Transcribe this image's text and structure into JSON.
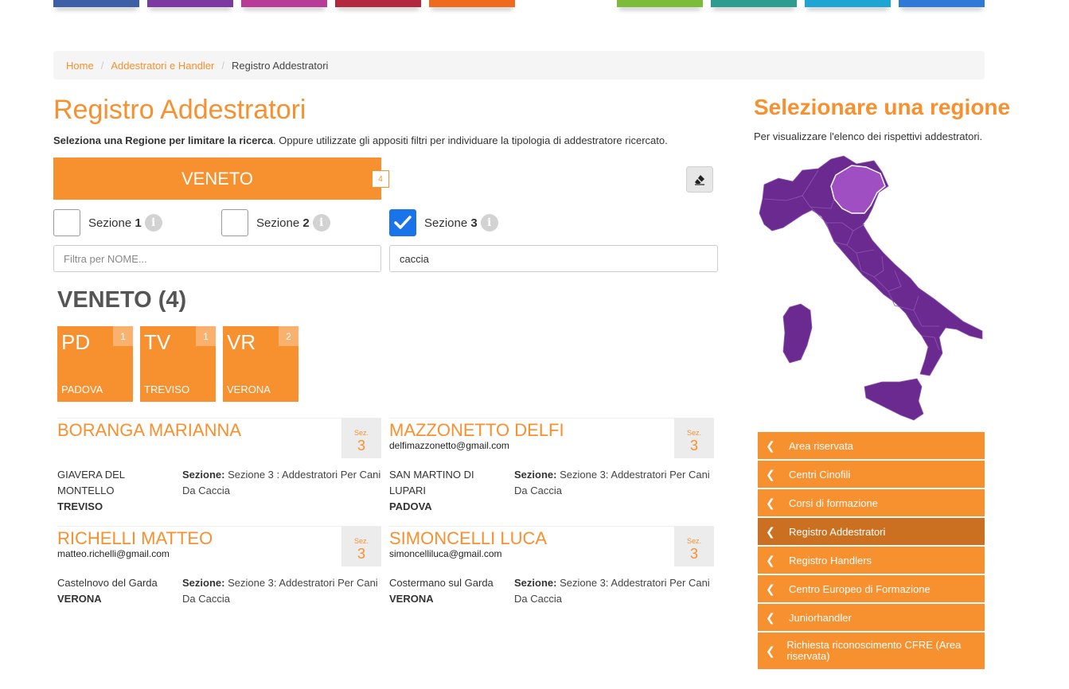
{
  "colors": {
    "accent": "#f7902f",
    "accent_dark": "#cb7020",
    "checkbox_checked": "#1a73e8",
    "map_fill": "#6b2a90",
    "map_selected": "#a04fc2",
    "top_tabs": [
      "#3d5fa8",
      "#7b3aa0",
      "#b83c96",
      "#b3283c",
      "#ef6a1e",
      "#ffffff",
      "#7cbc3a",
      "#2e9c8e",
      "#1fa5d4",
      "#2e7ad6"
    ]
  },
  "breadcrumb": {
    "home": "Home",
    "section": "Addestratori e Handler",
    "current": "Registro Addestratori"
  },
  "page": {
    "title": "Registro Addestratori",
    "intro_bold": "Seleziona una Regione per limitare la ricerca",
    "intro_rest": ". Oppure utilizzate gli appositi filtri per individuare la tipologia di addestratore ricercato."
  },
  "region_selector": {
    "label": "VENETO",
    "count": "4",
    "clear_icon": "eraser-icon"
  },
  "filters": {
    "sections": [
      {
        "prefix": "Sezione ",
        "number": "1",
        "checked": false
      },
      {
        "prefix": "Sezione ",
        "number": "2",
        "checked": false
      },
      {
        "prefix": "Sezione ",
        "number": "3",
        "checked": true
      }
    ],
    "name_placeholder": "Filtra per NOME...",
    "keyword_value": "caccia"
  },
  "results": {
    "heading": "VENETO (4)",
    "provinces": [
      {
        "code": "PD",
        "count": "1",
        "name": "PADOVA"
      },
      {
        "code": "TV",
        "count": "1",
        "name": "TREVISO"
      },
      {
        "code": "VR",
        "count": "2",
        "name": "VERONA"
      }
    ],
    "trainers": [
      {
        "name": "BORANGA MARIANNA",
        "email": "",
        "sez_label": "Sez.",
        "sez_num": "3",
        "town": "GIAVERA DEL MONTELLO",
        "province": "TREVISO",
        "section_label": "Sezione:",
        "section_text": " Sezione 3 : Addestratori Per Cani Da Caccia"
      },
      {
        "name": "MAZZONETTO DELFI",
        "email": "delfimazzonetto@gmail.com",
        "sez_label": "Sez.",
        "sez_num": "3",
        "town": "SAN MARTINO DI LUPARI",
        "province": "PADOVA",
        "section_label": "Sezione:",
        "section_text": " Sezione 3: Addestratori Per Cani Da Caccia"
      },
      {
        "name": "RICHELLI MATTEO",
        "email": "matteo.richelli@gmail.com",
        "sez_label": "Sez.",
        "sez_num": "3",
        "town": "Castelnovo del Garda",
        "province": "VERONA",
        "section_label": "Sezione:",
        "section_text": " Sezione 3: Addestratori Per Cani Da Caccia"
      },
      {
        "name": "SIMONCELLI LUCA",
        "email": "simoncelliluca@gmail.com",
        "sez_label": "Sez.",
        "sez_num": "3",
        "town": "Costermano sul Garda",
        "province": "VERONA",
        "section_label": "Sezione:",
        "section_text": " Sezione 3: Addestratori Per Cani Da Caccia"
      }
    ]
  },
  "sidebar": {
    "title": "Selezionare una regione",
    "subtitle": "Per visualizzare l'elenco dei rispettivi addestratori.",
    "map_selected_region": "VENETO",
    "menu": [
      {
        "label": "Area riservata",
        "active": false
      },
      {
        "label": "Centri Cinofili",
        "active": false
      },
      {
        "label": "Corsi di formazione",
        "active": false
      },
      {
        "label": "Registro Addestratori",
        "active": true
      },
      {
        "label": "Registro Handlers",
        "active": false
      },
      {
        "label": "Centro Europeo di Formazione",
        "active": false
      },
      {
        "label": "Juniorhandler",
        "active": false
      },
      {
        "label": "Richiesta riconoscimento CFRE (Area riservata)",
        "active": false
      }
    ]
  }
}
